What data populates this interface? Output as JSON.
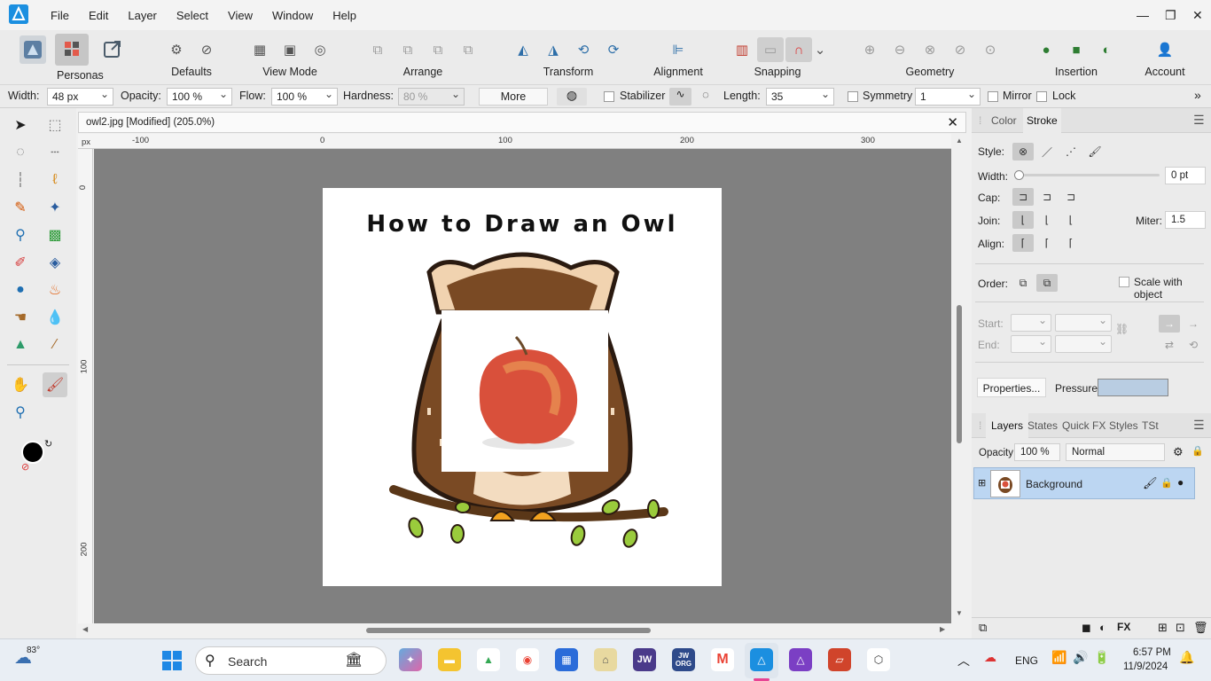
{
  "app": {
    "menus": [
      "File",
      "Edit",
      "Layer",
      "Select",
      "View",
      "Window",
      "Help"
    ],
    "window_controls": {
      "minimize": "—",
      "restore": "❐",
      "close": "✕"
    }
  },
  "toolbar": {
    "personas": "Personas",
    "defaults": "Defaults",
    "view_mode": "View Mode",
    "arrange": "Arrange",
    "transform": "Transform",
    "alignment": "Alignment",
    "snapping": "Snapping",
    "geometry": "Geometry",
    "insertion": "Insertion",
    "account": "Account"
  },
  "context": {
    "width_label": "Width:",
    "width_value": "48 px",
    "opacity_label": "Opacity:",
    "opacity_value": "100 %",
    "flow_label": "Flow:",
    "flow_value": "100 %",
    "hardness_label": "Hardness:",
    "hardness_value": "80 %",
    "more": "More",
    "stabilizer": "Stabilizer",
    "length_label": "Length:",
    "length_value": "35",
    "symmetry": "Symmetry",
    "symmetry_value": "1",
    "mirror": "Mirror",
    "lock": "Lock",
    "overflow": "»"
  },
  "document": {
    "tab_title": "owl2.jpg [Modified] (205.0%)",
    "ruler_unit": "px",
    "hruler_labels": [
      "-100",
      "0",
      "100",
      "200",
      "300"
    ],
    "vruler_labels": [
      "0",
      "100",
      "200"
    ],
    "image_title": "How to Draw an Owl"
  },
  "stroke_panel": {
    "tabs": [
      "Color",
      "Stroke"
    ],
    "style_label": "Style:",
    "width_label": "Width:",
    "width_value": "0 pt",
    "cap_label": "Cap:",
    "join_label": "Join:",
    "miter_label": "Miter:",
    "miter_value": "1.5",
    "align_label": "Align:",
    "order_label": "Order:",
    "scale_with_object": "Scale with object",
    "start_label": "Start:",
    "end_label": "End:",
    "properties_button": "Properties...",
    "pressure_label": "Pressure:"
  },
  "layers_panel": {
    "tabs": [
      "Layers",
      "States",
      "Quick FX",
      "Styles",
      "TSt"
    ],
    "opacity_label": "Opacity:",
    "opacity_value": "100 %",
    "blend_mode": "Normal",
    "layers": [
      {
        "name": "Background"
      }
    ]
  },
  "taskbar": {
    "weather_temp": "83°",
    "search_placeholder": "Search",
    "language": "ENG",
    "time": "6:57 PM",
    "date": "11/9/2024",
    "jw_label": "JW",
    "jworg_label": "JW ORG"
  },
  "colors": {
    "accent": "#1b8fe0",
    "canvas_bg": "#808080",
    "selected_layer": "#bcd6f2"
  }
}
